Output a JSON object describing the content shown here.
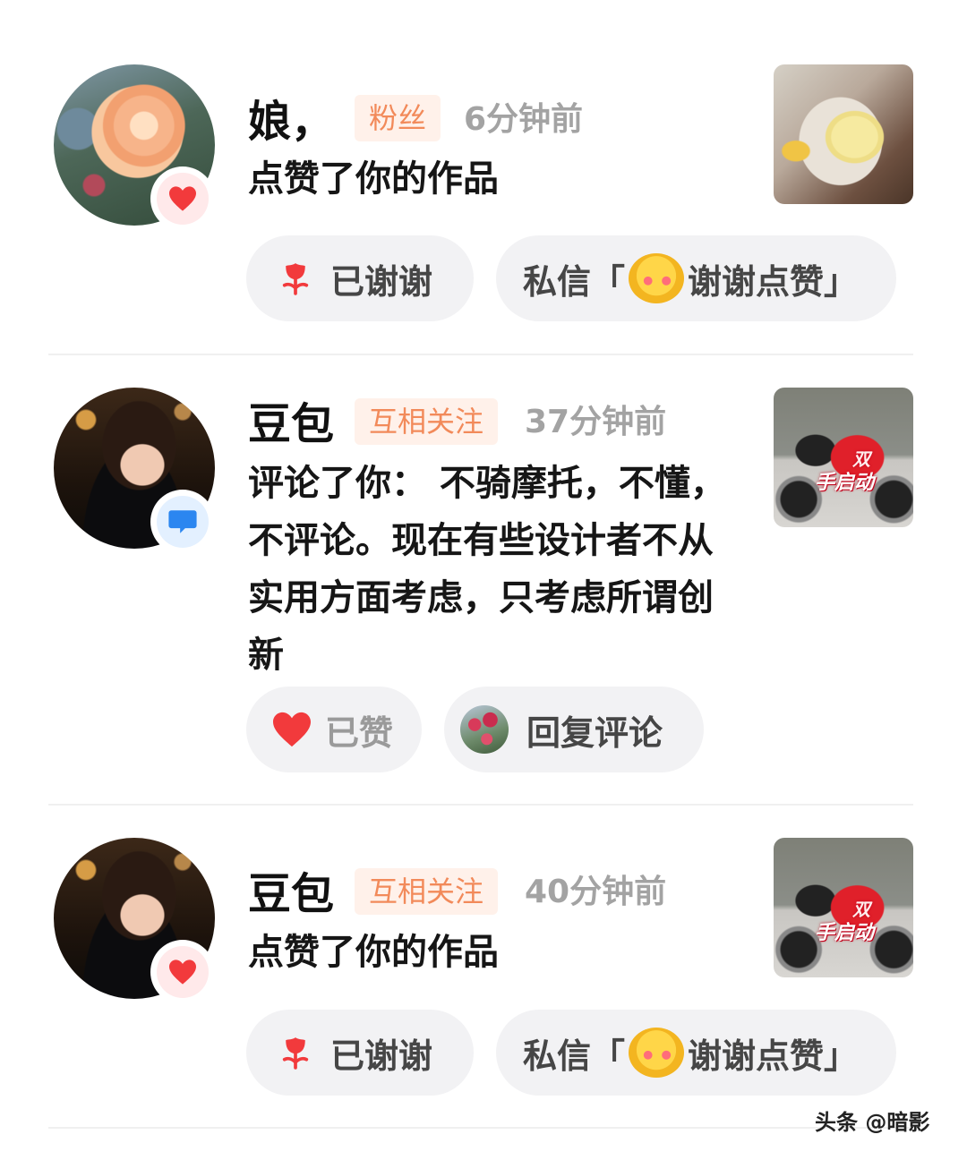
{
  "notifications": [
    {
      "name": "娘，",
      "tag": "粉丝",
      "time": "6分钟前",
      "action": "点赞了你的作品",
      "buttons": {
        "thanked": "已谢谢",
        "dm_prefix": "私信「",
        "dm_text": "谢谢点赞」"
      }
    },
    {
      "name": "豆包",
      "tag": "互相关注",
      "time": "37分钟前",
      "action": "评论了你：  不骑摩托，不懂，不评论。现在有些设计者不从实用方面考虑，只考虑所谓创新",
      "thumb_text": "手启动",
      "thumb_text2": "双",
      "buttons": {
        "liked": "已赞",
        "reply": "回复评论"
      }
    },
    {
      "name": "豆包",
      "tag": "互相关注",
      "time": "40分钟前",
      "action": "点赞了你的作品",
      "thumb_text": "手启动",
      "thumb_text2": "双",
      "buttons": {
        "thanked": "已谢谢",
        "dm_prefix": "私信「",
        "dm_text": "谢谢点赞」"
      }
    }
  ],
  "watermark": "头条 @暗影",
  "colors": {
    "like_red": "#f23a3c",
    "comment_blue": "#2b86f0",
    "tag_bg": "#fff1ea",
    "tag_text": "#f28a5a"
  }
}
